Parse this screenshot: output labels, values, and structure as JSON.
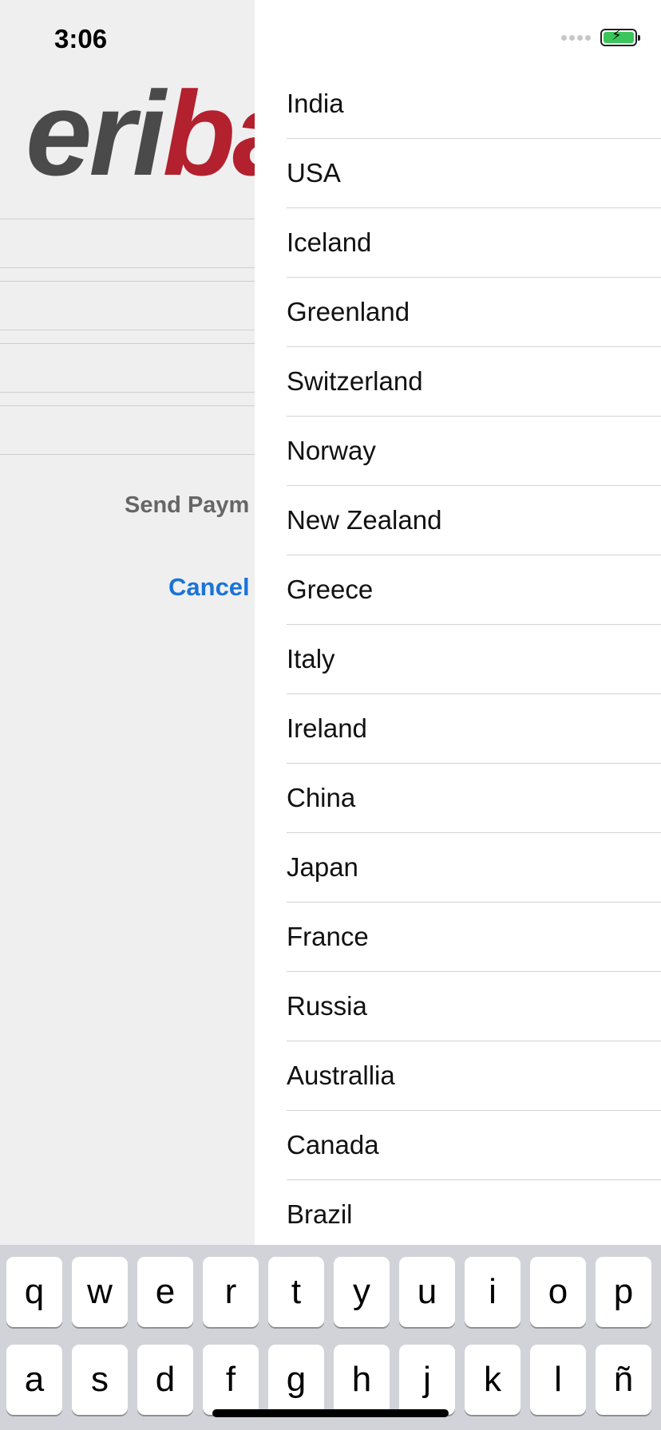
{
  "status": {
    "time": "3:06"
  },
  "background": {
    "logo_left": "eri",
    "logo_right": "ba",
    "send_button_label": "Send Paym",
    "cancel_label": "Cancel"
  },
  "countries": [
    "India",
    "USA",
    "Iceland",
    "Greenland",
    "Switzerland",
    "Norway",
    "New Zealand",
    "Greece",
    "Italy",
    "Ireland",
    "China",
    "Japan",
    "France",
    "Russia",
    "Australlia",
    "Canada",
    "Brazil"
  ],
  "keyboard": {
    "row1": [
      "q",
      "w",
      "e",
      "r",
      "t",
      "y",
      "u",
      "i",
      "o",
      "p"
    ],
    "row2": [
      "a",
      "s",
      "d",
      "f",
      "g",
      "h",
      "j",
      "k",
      "l",
      "ñ"
    ]
  },
  "colors": {
    "accent": "#1a73d9",
    "brand_red": "#b3202e",
    "battery": "#3bc55a"
  }
}
